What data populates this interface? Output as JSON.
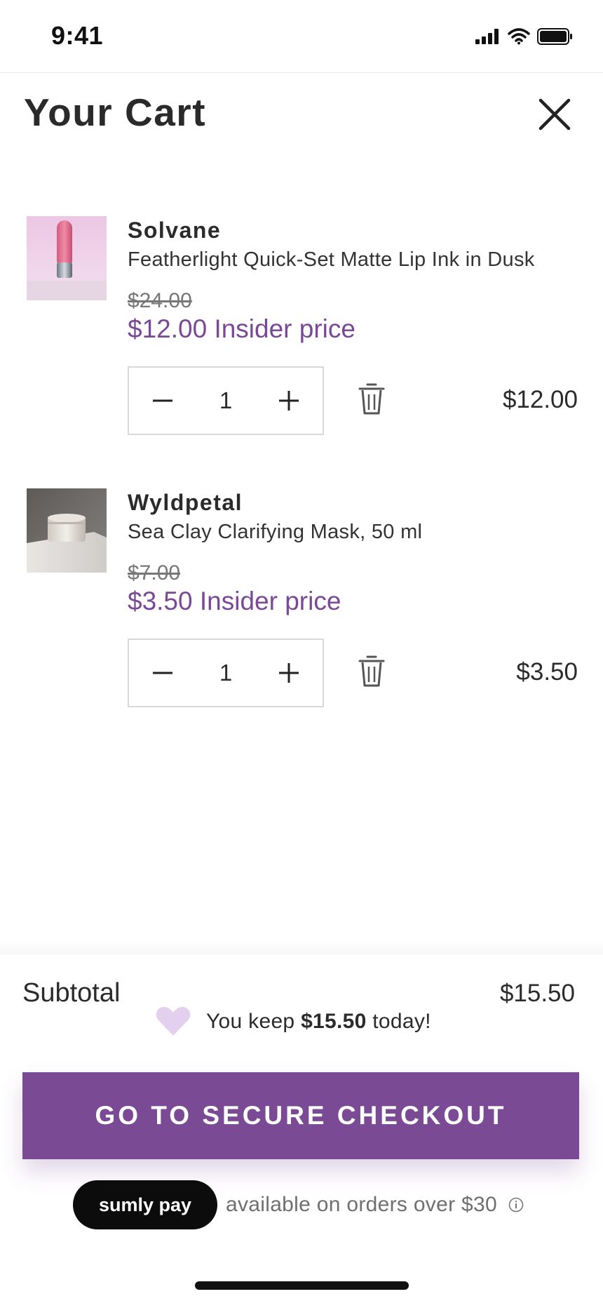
{
  "status_bar": {
    "time": "9:41"
  },
  "header": {
    "title": "Your Cart"
  },
  "items": [
    {
      "brand": "Solvane",
      "name": "Featherlight Quick-Set Matte Lip Ink in Dusk",
      "original_price": "$24.00",
      "insider_price": "$12.00 Insider price",
      "quantity": "1",
      "line_total": "$12.00"
    },
    {
      "brand": "Wyldpetal",
      "name": "Sea Clay Clarifying Mask, 50 ml",
      "original_price": "$7.00",
      "insider_price": "$3.50 Insider price",
      "quantity": "1",
      "line_total": "$3.50"
    }
  ],
  "footer": {
    "subtotal_label": "Subtotal",
    "subtotal_value": "$15.50",
    "keep_prefix": "You keep ",
    "keep_amount": "$15.50",
    "keep_suffix": " today!",
    "checkout_label": "GO TO SECURE CHECKOUT",
    "pay_brand": "sumly pay",
    "pay_text": "available on orders over $30"
  },
  "colors": {
    "accent": "#7b4a95",
    "insider_text": "#7b4897",
    "heart": "#e3d0ef"
  },
  "icons": [
    "signal-icon",
    "wifi-icon",
    "battery-icon",
    "close-icon",
    "minus-icon",
    "plus-icon",
    "trash-icon",
    "heart-icon",
    "info-icon"
  ]
}
